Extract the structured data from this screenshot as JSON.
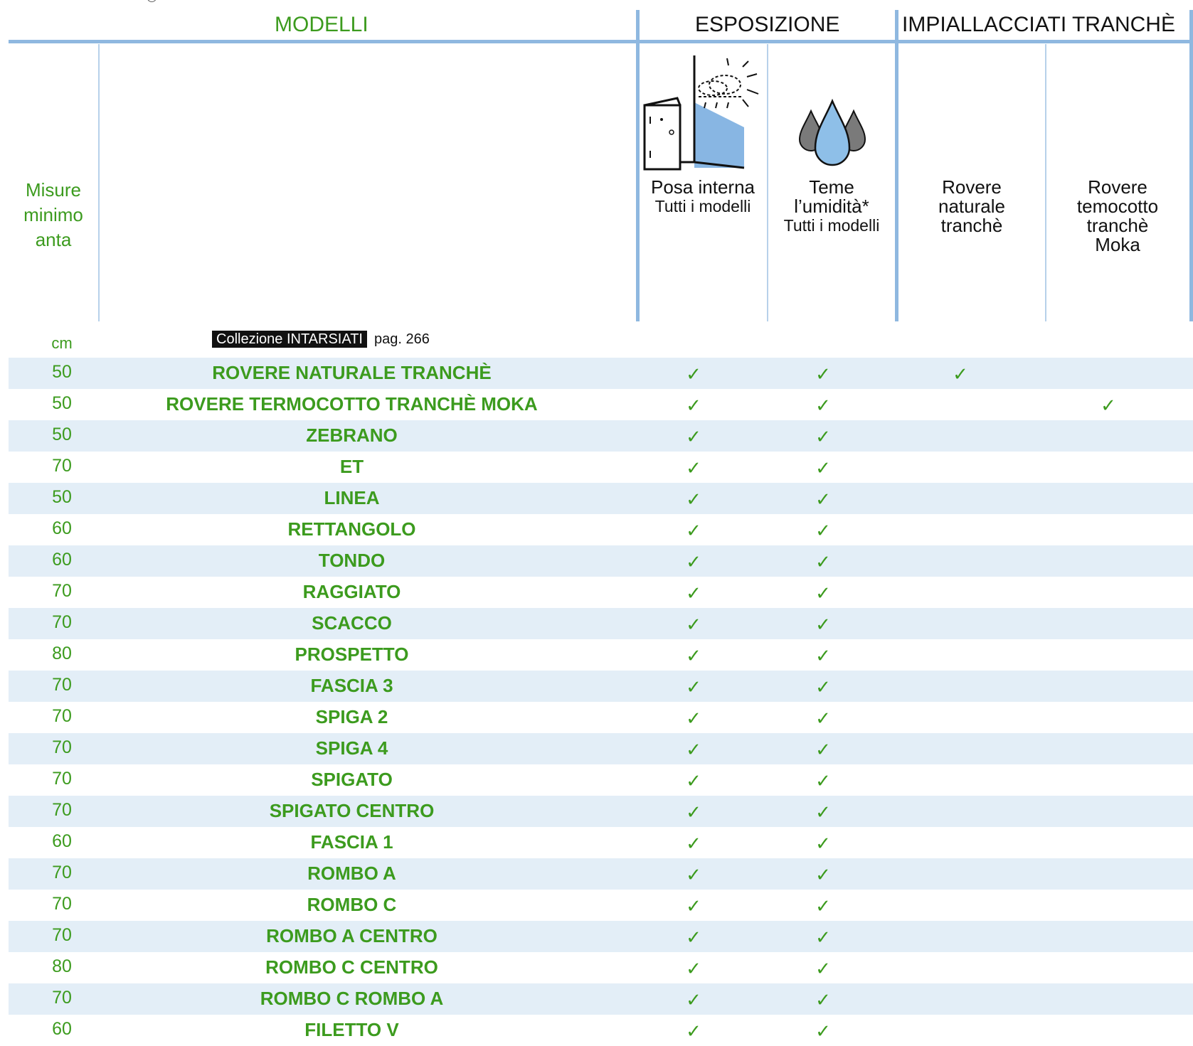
{
  "header": {
    "modelli": "MODELLI",
    "esposizione": "ESPOSIZIONE",
    "impiallacciati": "IMPIALLACCIATI TRANCHÈ",
    "misure_line1": "Misure",
    "misure_line2": "minimo",
    "misure_line3": "anta",
    "col_posa_1": "Posa interna",
    "col_posa_2": "Tutti i modelli",
    "col_umidita_1": "Teme",
    "col_umidita_2": "l’umidità*",
    "col_umidita_3": "Tutti i modelli",
    "col_rovere_nat_1": "Rovere",
    "col_rovere_nat_2": "naturale",
    "col_rovere_nat_3": "tranchè",
    "col_rovere_ter_1": "Rovere",
    "col_rovere_ter_2": "temocotto",
    "col_rovere_ter_3": "tranchè",
    "col_rovere_ter_4": "Moka",
    "registered_mark": "®"
  },
  "unit_label": "cm",
  "collection": {
    "tag": "Collezione INTARSIATI",
    "page": "pag. 266"
  },
  "check_glyph": "✓",
  "icons": [
    "door-interior-icon",
    "water-drops-icon"
  ],
  "colors": {
    "green": "#3c9b1e",
    "blue_rule": "#8fb8e0",
    "row_shade": "#e3eef7"
  },
  "rows": [
    {
      "size": "50",
      "name": "ROVERE NATURALE TRANCHÈ",
      "posa": true,
      "umidita": true,
      "nat": true,
      "ter": false
    },
    {
      "size": "50",
      "name": "ROVERE TERMOCOTTO TRANCHÈ MOKA",
      "posa": true,
      "umidita": true,
      "nat": false,
      "ter": true
    },
    {
      "size": "50",
      "name": "ZEBRANO",
      "posa": true,
      "umidita": true,
      "nat": false,
      "ter": false
    },
    {
      "size": "70",
      "name": "ET",
      "posa": true,
      "umidita": true,
      "nat": false,
      "ter": false
    },
    {
      "size": "50",
      "name": "LINEA",
      "posa": true,
      "umidita": true,
      "nat": false,
      "ter": false
    },
    {
      "size": "60",
      "name": "RETTANGOLO",
      "posa": true,
      "umidita": true,
      "nat": false,
      "ter": false
    },
    {
      "size": "60",
      "name": "TONDO",
      "posa": true,
      "umidita": true,
      "nat": false,
      "ter": false
    },
    {
      "size": "70",
      "name": "RAGGIATO",
      "posa": true,
      "umidita": true,
      "nat": false,
      "ter": false
    },
    {
      "size": "70",
      "name": "SCACCO",
      "posa": true,
      "umidita": true,
      "nat": false,
      "ter": false
    },
    {
      "size": "80",
      "name": "PROSPETTO",
      "posa": true,
      "umidita": true,
      "nat": false,
      "ter": false
    },
    {
      "size": "70",
      "name": "FASCIA 3",
      "posa": true,
      "umidita": true,
      "nat": false,
      "ter": false
    },
    {
      "size": "70",
      "name": "SPIGA 2",
      "posa": true,
      "umidita": true,
      "nat": false,
      "ter": false
    },
    {
      "size": "70",
      "name": "SPIGA 4",
      "posa": true,
      "umidita": true,
      "nat": false,
      "ter": false
    },
    {
      "size": "70",
      "name": "SPIGATO",
      "posa": true,
      "umidita": true,
      "nat": false,
      "ter": false
    },
    {
      "size": "70",
      "name": "SPIGATO CENTRO",
      "posa": true,
      "umidita": true,
      "nat": false,
      "ter": false
    },
    {
      "size": "60",
      "name": "FASCIA 1",
      "posa": true,
      "umidita": true,
      "nat": false,
      "ter": false
    },
    {
      "size": "70",
      "name": "ROMBO A",
      "posa": true,
      "umidita": true,
      "nat": false,
      "ter": false
    },
    {
      "size": "70",
      "name": "ROMBO C",
      "posa": true,
      "umidita": true,
      "nat": false,
      "ter": false
    },
    {
      "size": "70",
      "name": "ROMBO A CENTRO",
      "posa": true,
      "umidita": true,
      "nat": false,
      "ter": false
    },
    {
      "size": "80",
      "name": "ROMBO C CENTRO",
      "posa": true,
      "umidita": true,
      "nat": false,
      "ter": false
    },
    {
      "size": "70",
      "name": "ROMBO C ROMBO A",
      "posa": true,
      "umidita": true,
      "nat": false,
      "ter": false
    },
    {
      "size": "60",
      "name": "FILETTO V",
      "posa": true,
      "umidita": true,
      "nat": false,
      "ter": false
    }
  ]
}
